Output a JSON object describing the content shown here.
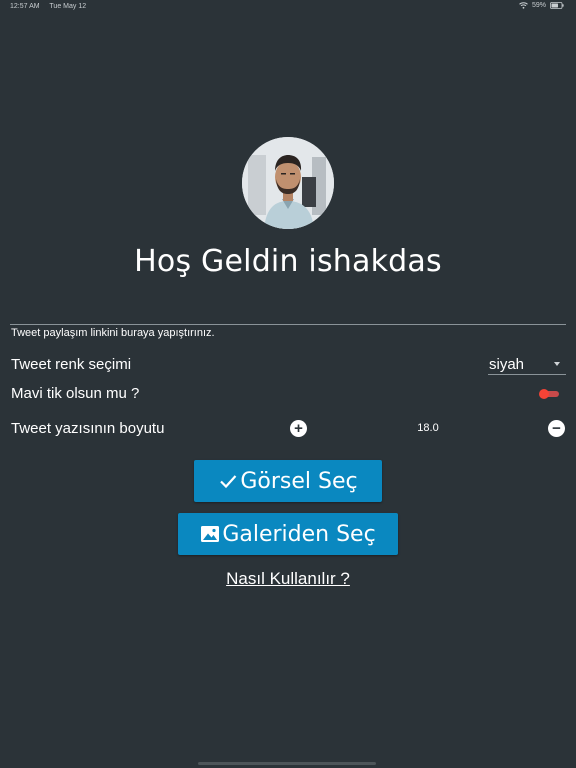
{
  "status_bar": {
    "time": "12:57 AM",
    "date": "Tue May 12",
    "battery": "59%"
  },
  "welcome": {
    "title": "Hoş Geldin ishakdas"
  },
  "tweet_link": {
    "label": "Tweet paylaşım linkini buraya yapıştırınız.",
    "value": ""
  },
  "color_selection": {
    "label": "Tweet renk seçimi",
    "selected": "siyah"
  },
  "blue_tick": {
    "label": "Mavi tik olsun mu ?",
    "enabled": true,
    "color": "#f44336"
  },
  "font_size": {
    "label": "Tweet yazısının boyutu",
    "value": "18.0",
    "increase": "+",
    "decrease": "−"
  },
  "buttons": {
    "select_image": "Görsel Seç",
    "gallery": "Galeriden Seç",
    "help": "Nasıl Kullanılır ?"
  },
  "colors": {
    "background": "#2b3338",
    "accent": "#0a88c0"
  }
}
